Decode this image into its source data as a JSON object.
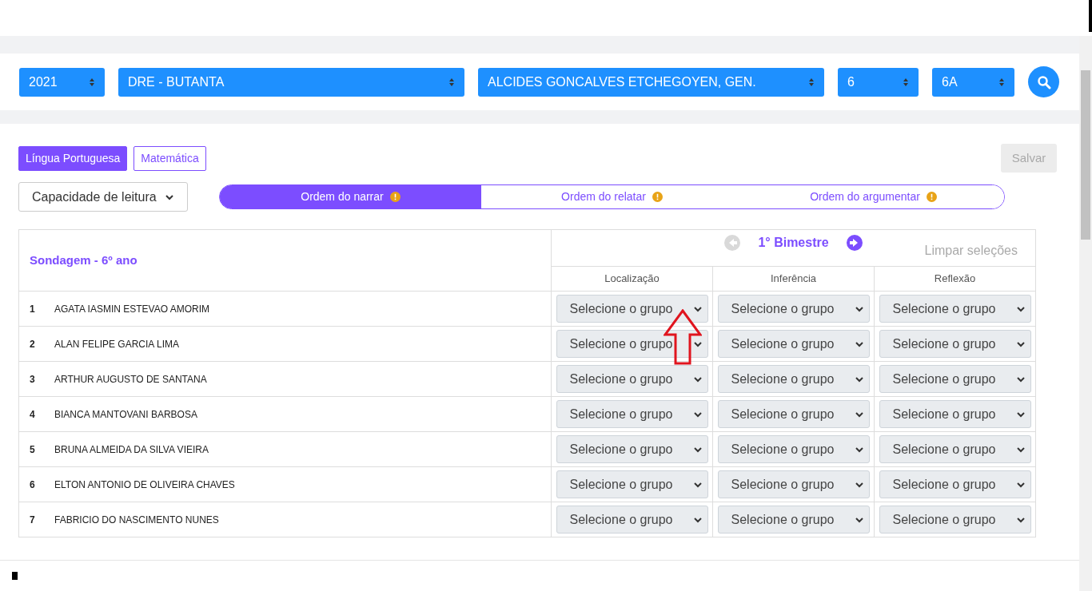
{
  "filters": [
    {
      "value": "2021"
    },
    {
      "value": "DRE - BUTANTA"
    },
    {
      "value": "ALCIDES GONCALVES ETCHEGOYEN, GEN."
    },
    {
      "value": "6"
    },
    {
      "value": "6A"
    }
  ],
  "subjects": [
    {
      "label": "Língua Portuguesa",
      "selected": true
    },
    {
      "label": "Matemática",
      "selected": false
    }
  ],
  "save_button": {
    "label": "Salvar",
    "disabled": true
  },
  "capacity_select": {
    "value": "Capacidade de leitura"
  },
  "orders": [
    {
      "label": "Ordem do narrar",
      "selected": true
    },
    {
      "label": "Ordem do relatar",
      "selected": false
    },
    {
      "label": "Ordem do argumentar",
      "selected": false
    }
  ],
  "table": {
    "title": "Sondagem - 6º ano",
    "period": "1° Bimestre",
    "prev_disabled": true,
    "next_disabled": false,
    "clear_link": "Limpar seleções",
    "columns": [
      "Localização",
      "Inferência",
      "Reflexão"
    ],
    "rows": [
      {
        "number": "1",
        "name": "AGATA IASMIN ESTEVAO AMORIM",
        "values": [
          "Selecione o grupo",
          "Selecione o grupo",
          "Selecione o grupo"
        ]
      },
      {
        "number": "2",
        "name": "ALAN FELIPE GARCIA LIMA",
        "values": [
          "Selecione o grupo",
          "Selecione o grupo",
          "Selecione o grupo"
        ]
      },
      {
        "number": "3",
        "name": "ARTHUR AUGUSTO DE SANTANA",
        "values": [
          "Selecione o grupo",
          "Selecione o grupo",
          "Selecione o grupo"
        ]
      },
      {
        "number": "4",
        "name": "BIANCA MANTOVANI BARBOSA",
        "values": [
          "Selecione o grupo",
          "Selecione o grupo",
          "Selecione o grupo"
        ]
      },
      {
        "number": "5",
        "name": "BRUNA ALMEIDA DA SILVA VIEIRA",
        "values": [
          "Selecione o grupo",
          "Selecione o grupo",
          "Selecione o grupo"
        ]
      },
      {
        "number": "6",
        "name": "ELTON ANTONIO DE OLIVEIRA CHAVES",
        "values": [
          "Selecione o grupo",
          "Selecione o grupo",
          "Selecione o grupo"
        ]
      },
      {
        "number": "7",
        "name": "FABRICIO DO NASCIMENTO NUNES",
        "values": [
          "Selecione o grupo",
          "Selecione o grupo",
          "Selecione o grupo"
        ]
      }
    ]
  }
}
